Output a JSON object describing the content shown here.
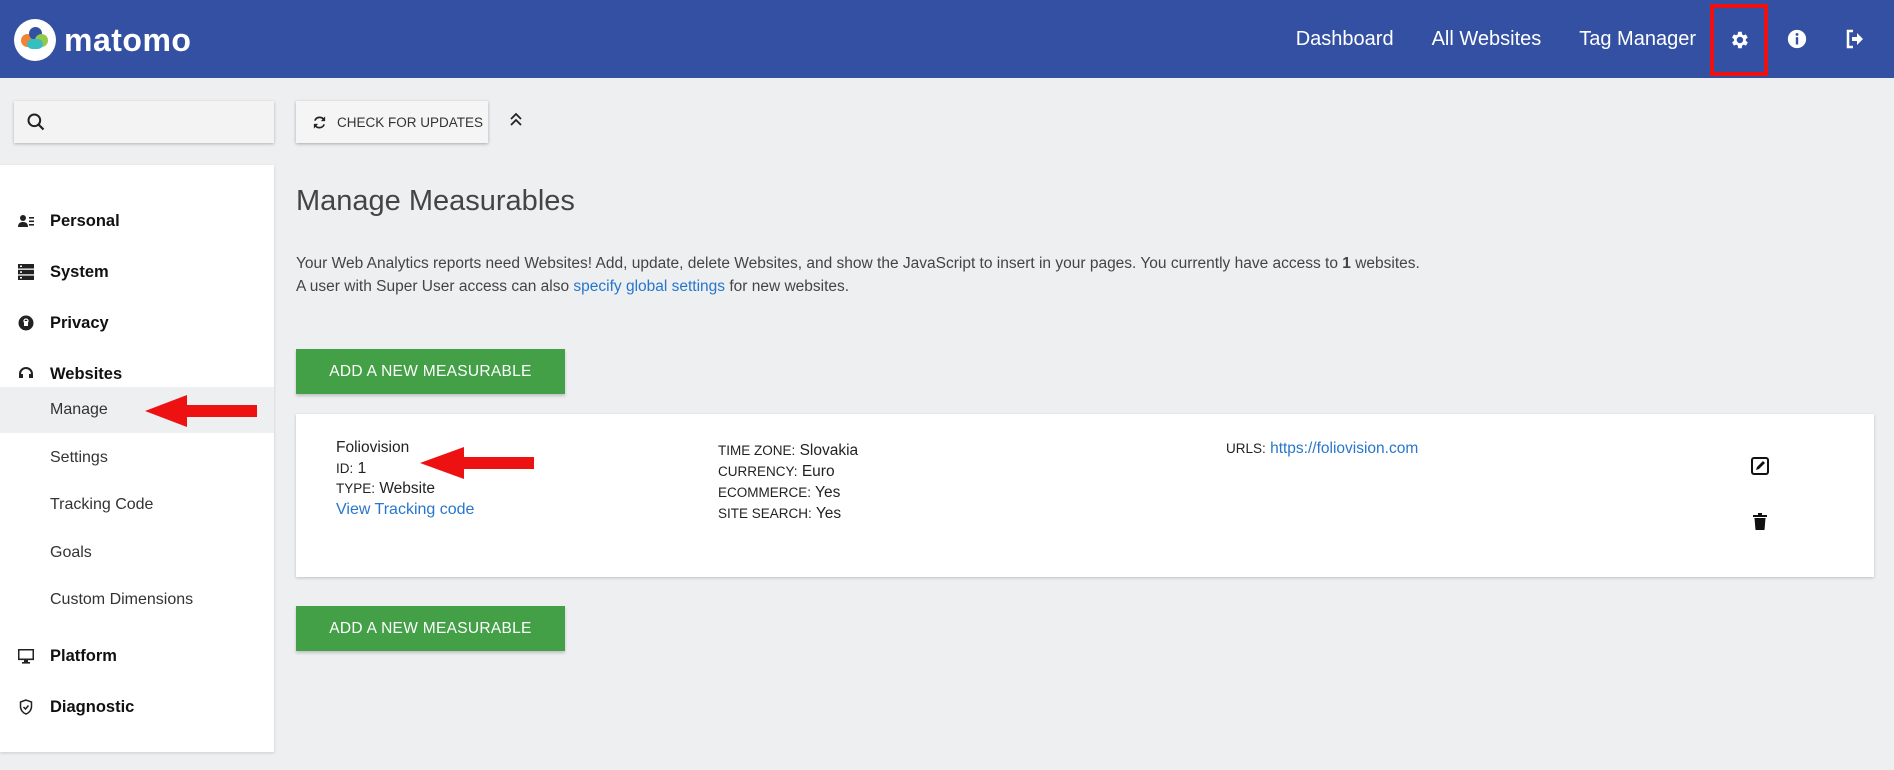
{
  "app": {
    "logo_text": "matomo"
  },
  "topnav": {
    "links": [
      "Dashboard",
      "All Websites",
      "Tag Manager"
    ],
    "icons": [
      "gear-icon",
      "info-icon",
      "logout-icon"
    ],
    "highlight_color": "#ee1111"
  },
  "search": {
    "placeholder": ""
  },
  "sidebar": {
    "sections": [
      {
        "label": "Personal",
        "icon": "personal-icon"
      },
      {
        "label": "System",
        "icon": "server-icon"
      },
      {
        "label": "Privacy",
        "icon": "lock-icon"
      },
      {
        "label": "Websites",
        "icon": "headset-icon"
      },
      {
        "label": "Platform",
        "icon": "monitor-icon"
      },
      {
        "label": "Diagnostic",
        "icon": "shield-icon"
      }
    ],
    "website_items": [
      {
        "label": "Manage",
        "active": true
      },
      {
        "label": "Settings"
      },
      {
        "label": "Tracking Code"
      },
      {
        "label": "Goals"
      },
      {
        "label": "Custom Dimensions"
      }
    ]
  },
  "toolbar": {
    "check_updates_label": "CHECK FOR UPDATES"
  },
  "main": {
    "title": "Manage Measurables",
    "intro_line1_start": "Your Web Analytics reports need Websites! Add, update, delete Websites, and show the JavaScript to insert in your pages. You currently have access to ",
    "intro_count": "1",
    "intro_line1_end": " websites.",
    "intro_line2_start": "A user with Super User access can also ",
    "intro_link": "specify global settings",
    "intro_line2_end": " for new websites.",
    "add_button_label": "ADD A NEW MEASURABLE"
  },
  "site": {
    "name": "Foliovision",
    "id_label": "ID:",
    "id_value": "1",
    "type_label": "TYPE:",
    "type_value": "Website",
    "tracking_link": "View Tracking code",
    "timezone_label": "TIME ZONE:",
    "timezone_value": "Slovakia",
    "currency_label": "CURRENCY:",
    "currency_value": "Euro",
    "ecommerce_label": "ECOMMERCE:",
    "ecommerce_value": "Yes",
    "sitesearch_label": "SITE SEARCH:",
    "sitesearch_value": "Yes",
    "urls_label": "URLS:",
    "url": "https://foliovision.com"
  },
  "colors": {
    "topbar": "#3450a3",
    "button": "#43a047",
    "link": "#2776cc",
    "arrow": "#ee1111"
  }
}
